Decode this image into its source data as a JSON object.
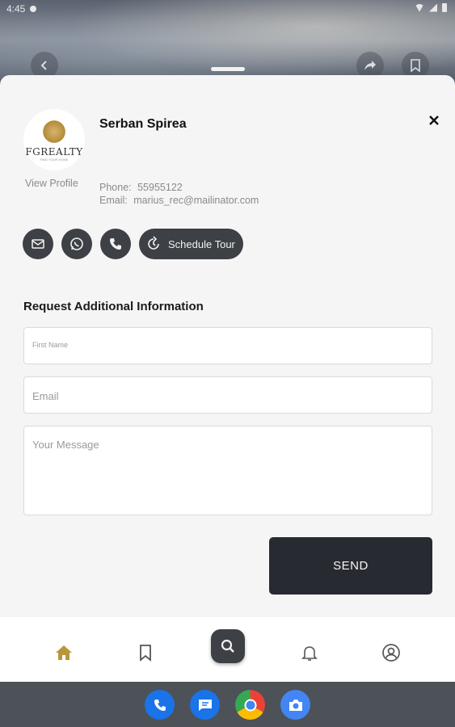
{
  "status_bar": {
    "time": "4:45"
  },
  "agent": {
    "name": "Serban Spirea",
    "logo_text": "FGREALTY",
    "logo_subtext": "FIND YOUR HOME",
    "view_profile_label": "View Profile",
    "phone_label": "Phone:",
    "phone": "55955122",
    "email_label": "Email:",
    "email": "marius_rec@mailinator.com"
  },
  "actions": {
    "schedule_tour_label": "Schedule Tour"
  },
  "form": {
    "title": "Request Additional Information",
    "first_name_placeholder": "First Name",
    "email_placeholder": "Email",
    "message_placeholder": "Your Message",
    "send_label": "SEND"
  },
  "nav": {
    "items": [
      "home-icon",
      "bookmark-icon",
      "search-icon",
      "bell-icon",
      "profile-icon"
    ],
    "active": "home",
    "active_color": "#b8963e",
    "inactive_color": "#555555"
  },
  "dock": {
    "apps": [
      "phone-app-icon",
      "messages-app-icon",
      "chrome-app-icon",
      "camera-app-icon"
    ]
  },
  "colors": {
    "dark_button": "#3d4045",
    "send_button": "#272a30",
    "accent_gold": "#b8963e"
  }
}
